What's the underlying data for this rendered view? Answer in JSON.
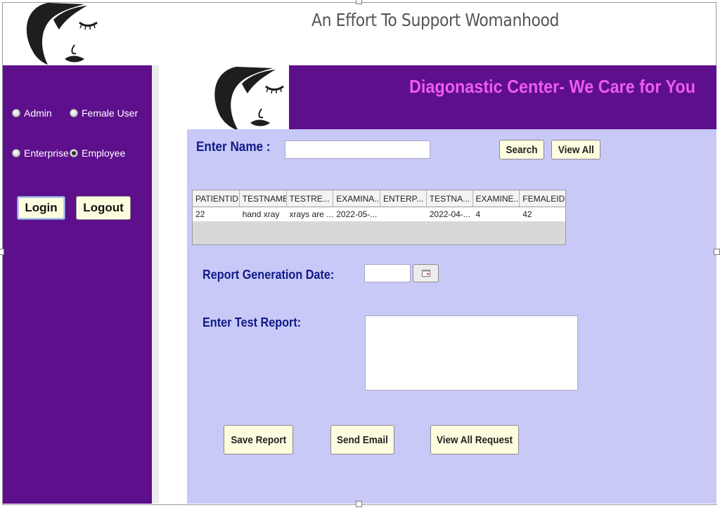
{
  "app": {
    "title": "An Effort To Support Womanhood"
  },
  "sidebar": {
    "radios": [
      {
        "label": "Admin",
        "checked": false
      },
      {
        "label": "Female User",
        "checked": false
      },
      {
        "label": "Enterprise",
        "checked": false
      },
      {
        "label": "Employee",
        "checked": true
      }
    ],
    "login_label": "Login",
    "logout_label": "Logout"
  },
  "banner": {
    "title": "Diagonastic Center- We Care for You"
  },
  "search": {
    "label": "Enter Name :",
    "value": "",
    "search_label": "Search",
    "view_all_label": "View All"
  },
  "table": {
    "columns": [
      "PATIENTID",
      "TESTNAME",
      "TESTRE...",
      "EXAMINA...",
      "ENTERP...",
      "TESTNA...",
      "EXAMINE...",
      "FEMALEID"
    ],
    "rows": [
      [
        "22",
        "hand xray",
        "xrays are ...",
        "2022-05-...",
        "",
        "2022-04-...",
        "4",
        "42"
      ]
    ]
  },
  "report": {
    "date_label": "Report Generation Date:",
    "date_value": "",
    "text_label": "Enter Test Report:",
    "text_value": ""
  },
  "actions": {
    "save_label": "Save Report",
    "email_label": "Send Email",
    "view_requests_label": "View All Request"
  },
  "colors": {
    "sidebar": "#5e0f8c",
    "panel": "#c9c9f8",
    "banner_text": "#ef5bef",
    "label": "#101a86",
    "button": "#fffde0"
  }
}
